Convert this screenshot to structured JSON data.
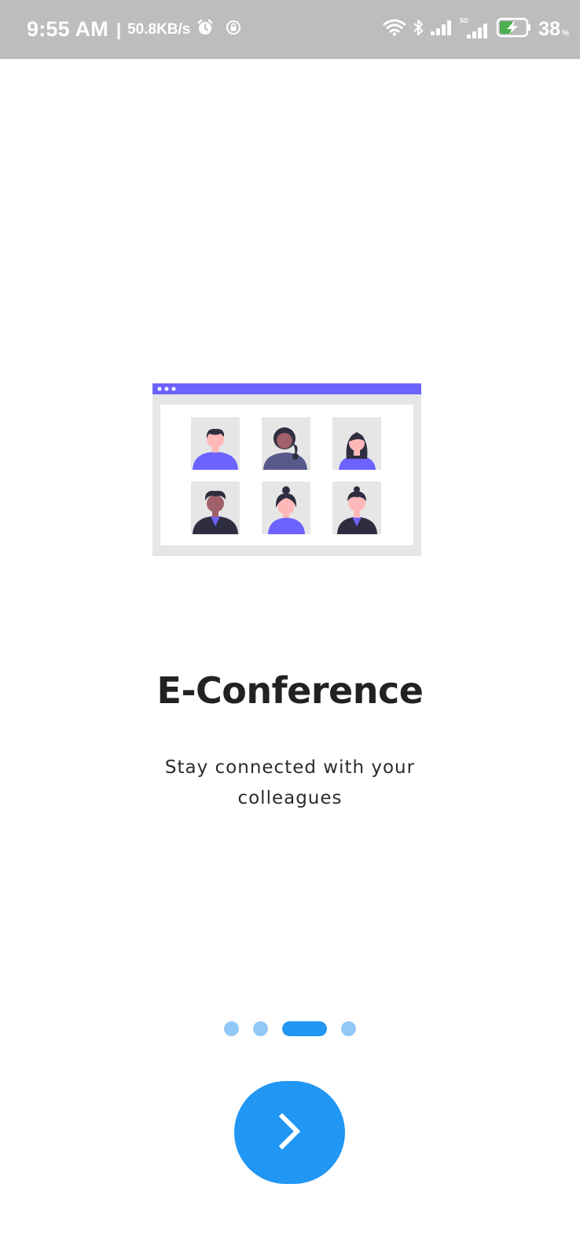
{
  "status_bar": {
    "time": "9:55 AM",
    "separator": "|",
    "net_speed": "50.8KB/s",
    "network_type": "5G",
    "battery_level": "38",
    "battery_unit": "%",
    "icons": [
      "alarm-icon",
      "screen-lock-icon",
      "wifi-icon",
      "bluetooth-icon",
      "signal-icon",
      "signal-5g-icon",
      "battery-charging-icon"
    ]
  },
  "onboarding": {
    "title": "E-Conference",
    "subtitle": "Stay connected with your colleagues",
    "pages_total": 4,
    "active_page": 3,
    "next_icon": "chevron-right-icon"
  },
  "colors": {
    "accent": "#2196f3",
    "accent_light": "#90c8f6",
    "illustration_purple": "#6c63ff",
    "status_bar_bg": "#bdbdbd"
  }
}
